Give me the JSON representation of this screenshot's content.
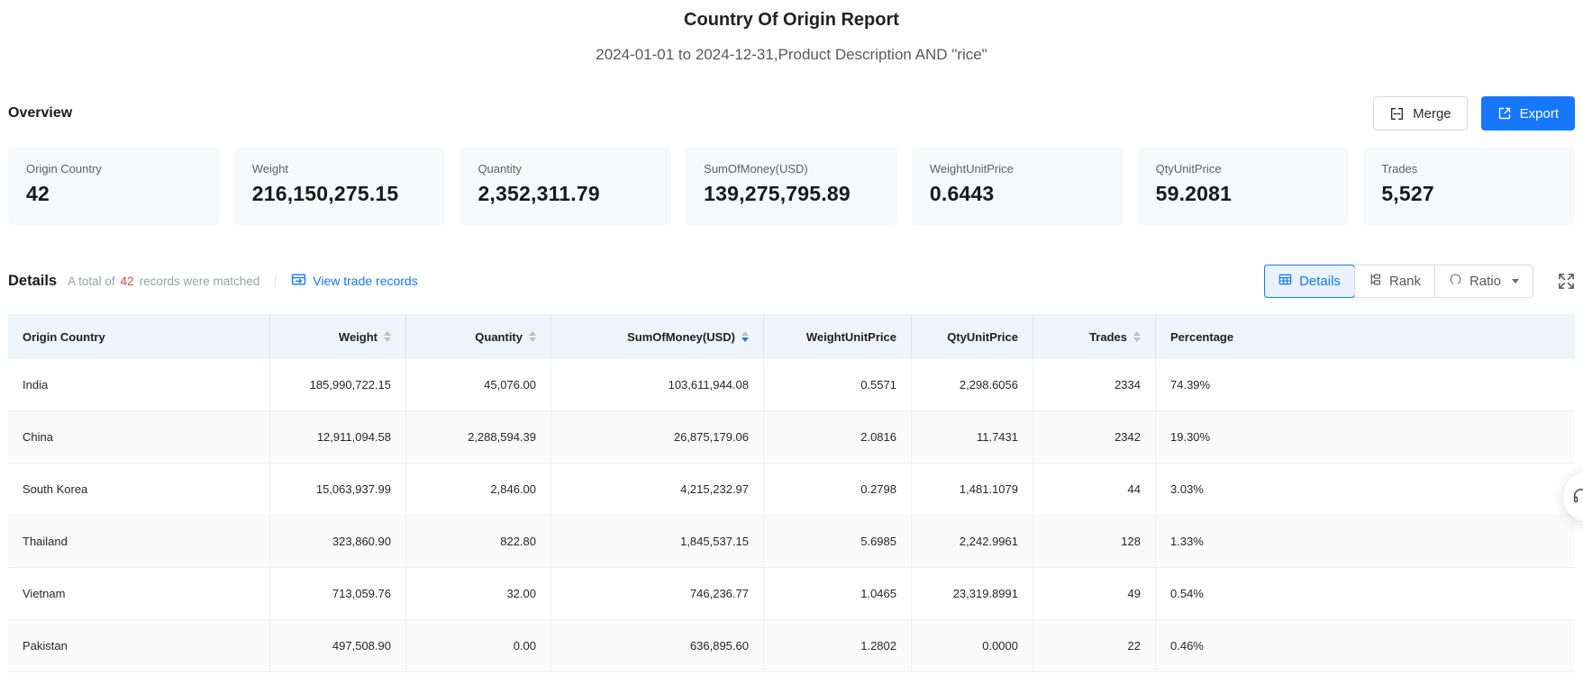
{
  "report": {
    "title": "Country Of Origin Report",
    "subtitle": "2024-01-01 to 2024-12-31,Product Description AND \"rice\""
  },
  "overview": {
    "heading": "Overview",
    "merge_label": "Merge",
    "export_label": "Export",
    "cards": [
      {
        "label": "Origin Country",
        "value": "42"
      },
      {
        "label": "Weight",
        "value": "216,150,275.15"
      },
      {
        "label": "Quantity",
        "value": "2,352,311.79"
      },
      {
        "label": "SumOfMoney(USD)",
        "value": "139,275,795.89"
      },
      {
        "label": "WeightUnitPrice",
        "value": "0.6443"
      },
      {
        "label": "QtyUnitPrice",
        "value": "59.2081"
      },
      {
        "label": "Trades",
        "value": "5,527"
      }
    ]
  },
  "details": {
    "heading": "Details",
    "total_prefix": "A total of",
    "total_count": "42",
    "total_suffix": "records were matched",
    "view_link": "View trade records",
    "tabs": {
      "details": "Details",
      "rank": "Rank",
      "ratio": "Ratio"
    }
  },
  "table": {
    "columns": [
      {
        "label": "Origin Country"
      },
      {
        "label": "Weight"
      },
      {
        "label": "Quantity"
      },
      {
        "label": "SumOfMoney(USD)"
      },
      {
        "label": "WeightUnitPrice"
      },
      {
        "label": "QtyUnitPrice"
      },
      {
        "label": "Trades"
      },
      {
        "label": "Percentage"
      }
    ],
    "sorted_column": "SumOfMoney(USD)",
    "sorted_direction": "descending",
    "rows": [
      {
        "country": "India",
        "weight": "185,990,722.15",
        "quantity": "45,076.00",
        "sum_of_money": "103,611,944.08",
        "weight_unit_price": "0.5571",
        "qty_unit_price": "2,298.6056",
        "trades": "2334",
        "percentage": "74.39%"
      },
      {
        "country": "China",
        "weight": "12,911,094.58",
        "quantity": "2,288,594.39",
        "sum_of_money": "26,875,179.06",
        "weight_unit_price": "2.0816",
        "qty_unit_price": "11.7431",
        "trades": "2342",
        "percentage": "19.30%"
      },
      {
        "country": "South Korea",
        "weight": "15,063,937.99",
        "quantity": "2,846.00",
        "sum_of_money": "4,215,232.97",
        "weight_unit_price": "0.2798",
        "qty_unit_price": "1,481.1079",
        "trades": "44",
        "percentage": "3.03%"
      },
      {
        "country": "Thailand",
        "weight": "323,860.90",
        "quantity": "822.80",
        "sum_of_money": "1,845,537.15",
        "weight_unit_price": "5.6985",
        "qty_unit_price": "2,242.9961",
        "trades": "128",
        "percentage": "1.33%"
      },
      {
        "country": "Vietnam",
        "weight": "713,059.76",
        "quantity": "32.00",
        "sum_of_money": "746,236.77",
        "weight_unit_price": "1.0465",
        "qty_unit_price": "23,319.8991",
        "trades": "49",
        "percentage": "0.54%"
      },
      {
        "country": "Pakistan",
        "weight": "497,508.90",
        "quantity": "0.00",
        "sum_of_money": "636,895.60",
        "weight_unit_price": "1.2802",
        "qty_unit_price": "0.0000",
        "trades": "22",
        "percentage": "0.46%"
      }
    ]
  },
  "colors": {
    "accent_blue": "#1677ff",
    "count_red": "#f53f3f",
    "table_header_bg": "#eff3fb",
    "card_bg": "#f7f8fa",
    "active_tab_bg": "#e8f1fd"
  }
}
